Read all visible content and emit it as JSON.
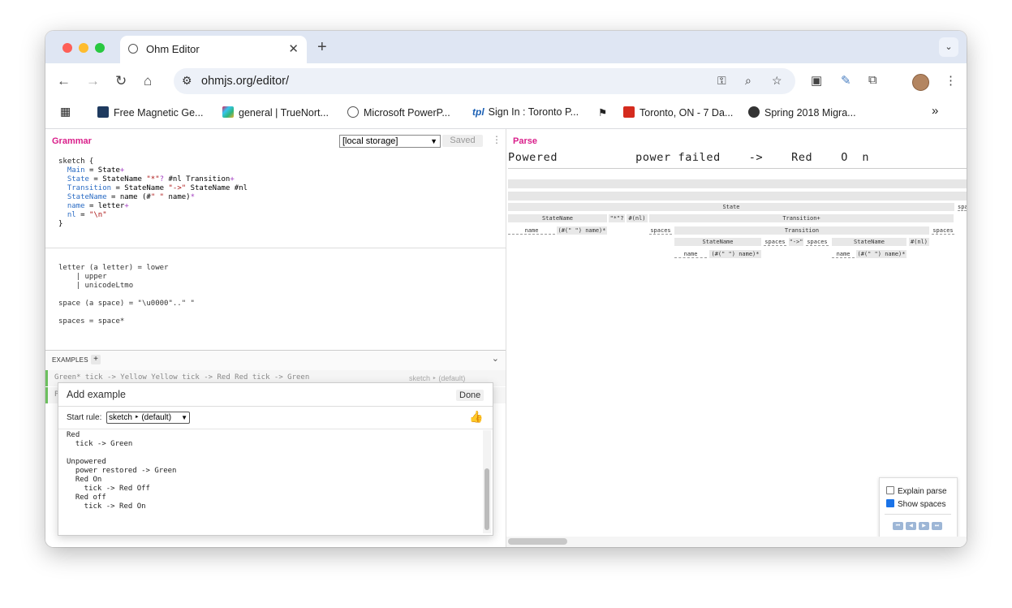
{
  "browser": {
    "tab_title": "Ohm Editor",
    "url": "ohmjs.org/editor/",
    "bookmarks": [
      "Free Magnetic Ge...",
      "general | TrueNort...",
      "Microsoft PowerP...",
      "Sign In : Toronto P...",
      "Toronto, ON - 7 Da...",
      "Spring 2018 Migra..."
    ],
    "bookmark_prefix_tpl": "tpl",
    "more_bookmarks": "»"
  },
  "grammar": {
    "header": "Grammar",
    "storage_select": "[local storage]",
    "saved_label": "Saved",
    "code_part2": "letter (a letter) = lower\n    | upper\n    | unicodeLtmo\n\nspace (a space) = \"\\u0000\"..\" \"\n\nspaces = space*"
  },
  "examples": {
    "label": "EXAMPLES",
    "add": "+",
    "rows": [
      {
        "text": "Green* tick -> Yellow Yellow tick -> Red Red tick -> Green",
        "rule": "sketch ‣ (default)"
      },
      {
        "text": "P",
        "rule": ""
      }
    ]
  },
  "dialog": {
    "title": "Add example",
    "done": "Done",
    "start_rule_label": "Start rule:",
    "start_rule_value": "sketch ‣ (default)",
    "text": "Red\n  tick -> Green\n\nUnpowered\n  power restored -> Green\n  Red On\n    tick -> Red Off\n  Red off\n    tick -> Red On"
  },
  "parse": {
    "header": "Parse",
    "input": "Powered           power failed    ->    Red    O  n",
    "nodes": {
      "state": "State",
      "spa": "spa",
      "state_name": "StateName",
      "star_q": "\"*\"?",
      "nl": "#(nl)",
      "transition_plus": "Transition+",
      "name": "name",
      "name_star": "(#(\" \") name)*",
      "spaces": "spaces",
      "transition": "Transition",
      "arrow": "\"->\""
    },
    "options": {
      "explain": "Explain parse",
      "explain_checked": false,
      "show_spaces": "Show spaces",
      "show_spaces_checked": true
    }
  }
}
